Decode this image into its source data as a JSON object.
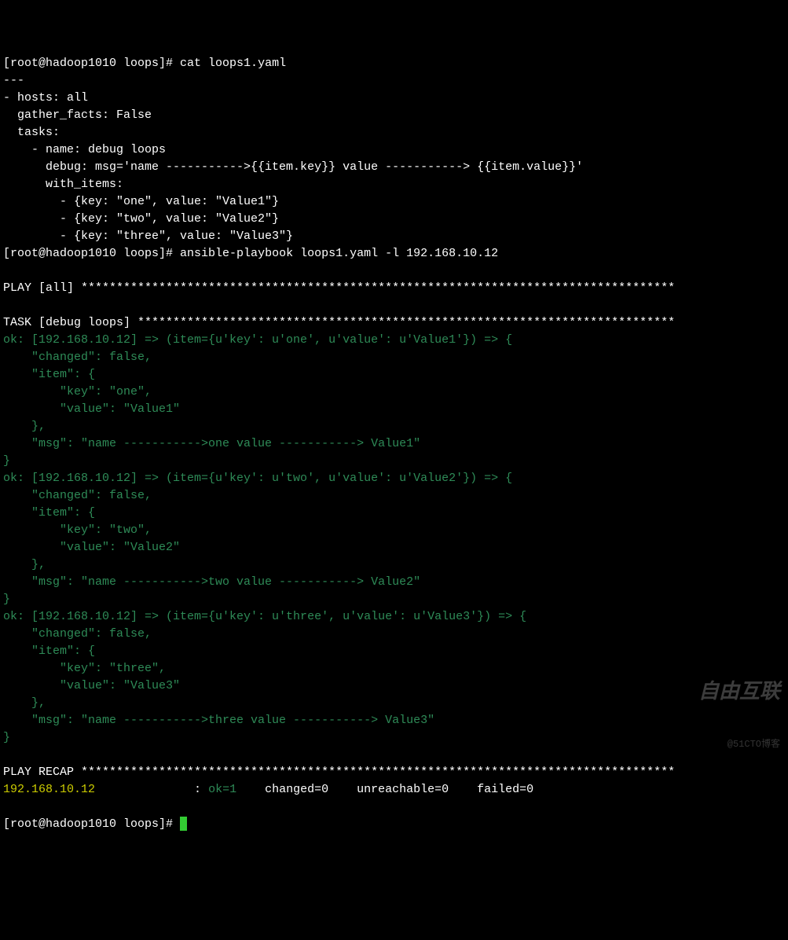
{
  "prompt1": "[root@hadoop1010 loops]# ",
  "cmd1": "cat loops1.yaml",
  "yaml": {
    "l1": "---",
    "l2": "- hosts: all",
    "l3": "  gather_facts: False",
    "l4": "  tasks:",
    "l5": "    - name: debug loops",
    "l6": "      debug: msg='name ----------->{{item.key}} value -----------> {{item.value}}'",
    "l7": "      with_items:",
    "l8": "        - {key: \"one\", value: \"Value1\"}",
    "l9": "        - {key: \"two\", value: \"Value2\"}",
    "l10": "        - {key: \"three\", value: \"Value3\"}"
  },
  "prompt2": "[root@hadoop1010 loops]# ",
  "cmd2": "ansible-playbook loops1.yaml -l 192.168.10.12",
  "blank": "",
  "play_header": "PLAY [all] ************************************************************************************",
  "task_header": "TASK [debug loops] ****************************************************************************",
  "ok1": {
    "line1": "ok: [192.168.10.12] => (item={u'key': u'one', u'value': u'Value1'}) => {",
    "line2": "    \"changed\": false,",
    "line3": "    \"item\": {",
    "line4": "        \"key\": \"one\",",
    "line5": "        \"value\": \"Value1\"",
    "line6": "    },",
    "line7": "    \"msg\": \"name ----------->one value -----------> Value1\"",
    "line8": "}"
  },
  "ok2": {
    "line1": "ok: [192.168.10.12] => (item={u'key': u'two', u'value': u'Value2'}) => {",
    "line2": "    \"changed\": false,",
    "line3": "    \"item\": {",
    "line4": "        \"key\": \"two\",",
    "line5": "        \"value\": \"Value2\"",
    "line6": "    },",
    "line7": "    \"msg\": \"name ----------->two value -----------> Value2\"",
    "line8": "}"
  },
  "ok3": {
    "line1": "ok: [192.168.10.12] => (item={u'key': u'three', u'value': u'Value3'}) => {",
    "line2": "    \"changed\": false,",
    "line3": "    \"item\": {",
    "line4": "        \"key\": \"three\",",
    "line5": "        \"value\": \"Value3\"",
    "line6": "    },",
    "line7": "    \"msg\": \"name ----------->three value -----------> Value3\"",
    "line8": "}"
  },
  "recap_header": "PLAY RECAP ************************************************************************************",
  "recap": {
    "host": "192.168.10.12              ",
    "colon": ": ",
    "ok": "ok=1   ",
    "rest": " changed=0    unreachable=0    failed=0   "
  },
  "prompt3": "[root@hadoop1010 loops]# ",
  "watermark": {
    "main": "自由互联",
    "sub": "@51CTO博客"
  }
}
